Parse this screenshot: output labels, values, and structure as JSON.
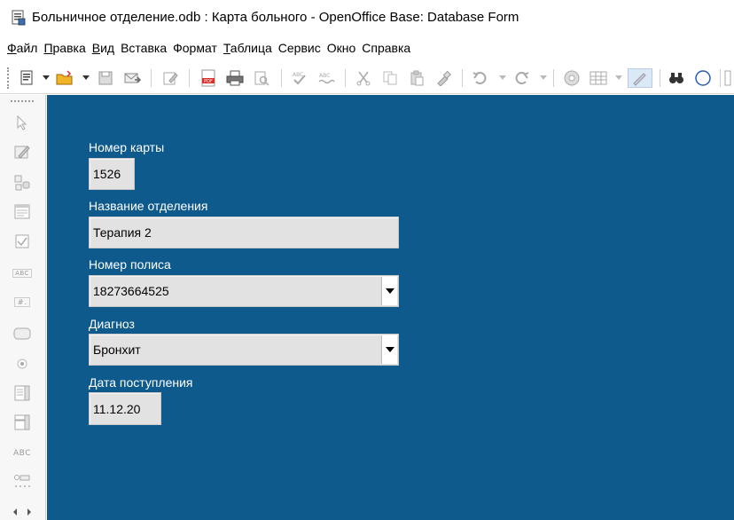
{
  "window": {
    "title": "Больничное отделение.odb : Карта больного - OpenOffice Base: Database Form"
  },
  "menu": {
    "items": [
      {
        "ul": "Ф",
        "rest": "айл"
      },
      {
        "ul": "П",
        "rest": "равка"
      },
      {
        "ul": "В",
        "rest": "ид"
      },
      {
        "ul": "",
        "rest": "Вставка"
      },
      {
        "ul": "",
        "rest": "Формат"
      },
      {
        "ul": "Т",
        "rest": "аблица"
      },
      {
        "ul": "",
        "rest": "Сервис"
      },
      {
        "ul": "",
        "rest": "Окно"
      },
      {
        "ul": "",
        "rest": "Справка"
      }
    ],
    "full": [
      "Файл",
      "Правка",
      "Вид",
      "Вставка",
      "Формат",
      "Таблица",
      "Сервис",
      "Окно",
      "Справка"
    ]
  },
  "toolbar": {
    "icons": [
      "edit-file-icon",
      "open-folder-icon",
      "save-icon",
      "email-icon",
      "edit-mode-icon",
      "export-pdf-icon",
      "print-icon",
      "page-preview-icon",
      "spellcheck-icon",
      "autospellcheck-icon",
      "cut-icon",
      "copy-icon",
      "paste-icon",
      "clone-format-icon",
      "undo-icon",
      "redo-icon",
      "navigator-icon",
      "table-icon",
      "draw-icon",
      "find-icon",
      "hyperlink-icon"
    ]
  },
  "sidebar": {
    "icons": [
      "select-pointer-icon",
      "design-mode-icon",
      "form-control-icon",
      "form-properties-icon",
      "checkbox-icon",
      "text-box-icon",
      "formatted-field-icon",
      "push-button-icon",
      "option-button-icon",
      "list-box-icon",
      "combo-box-icon",
      "label-field-icon",
      "more-controls-icon"
    ],
    "text_box_label": "ABC",
    "formatted_label": "#.",
    "label_field_label": "ABC"
  },
  "form": {
    "fields": [
      {
        "label": "Номер карты",
        "value": "1526",
        "type": "text"
      },
      {
        "label": "Название отделения",
        "value": "Терапия 2",
        "type": "text"
      },
      {
        "label": "Номер полиса",
        "value": "18273664525",
        "type": "dropdown"
      },
      {
        "label": "Диагноз",
        "value": "Бронхит",
        "type": "dropdown"
      },
      {
        "label": "Дата поступления",
        "value": "11.12.20",
        "type": "text"
      }
    ]
  },
  "colors": {
    "form_background": "#0e5a8c",
    "field_background": "#e2e2e2",
    "label_color": "#ffffff"
  }
}
